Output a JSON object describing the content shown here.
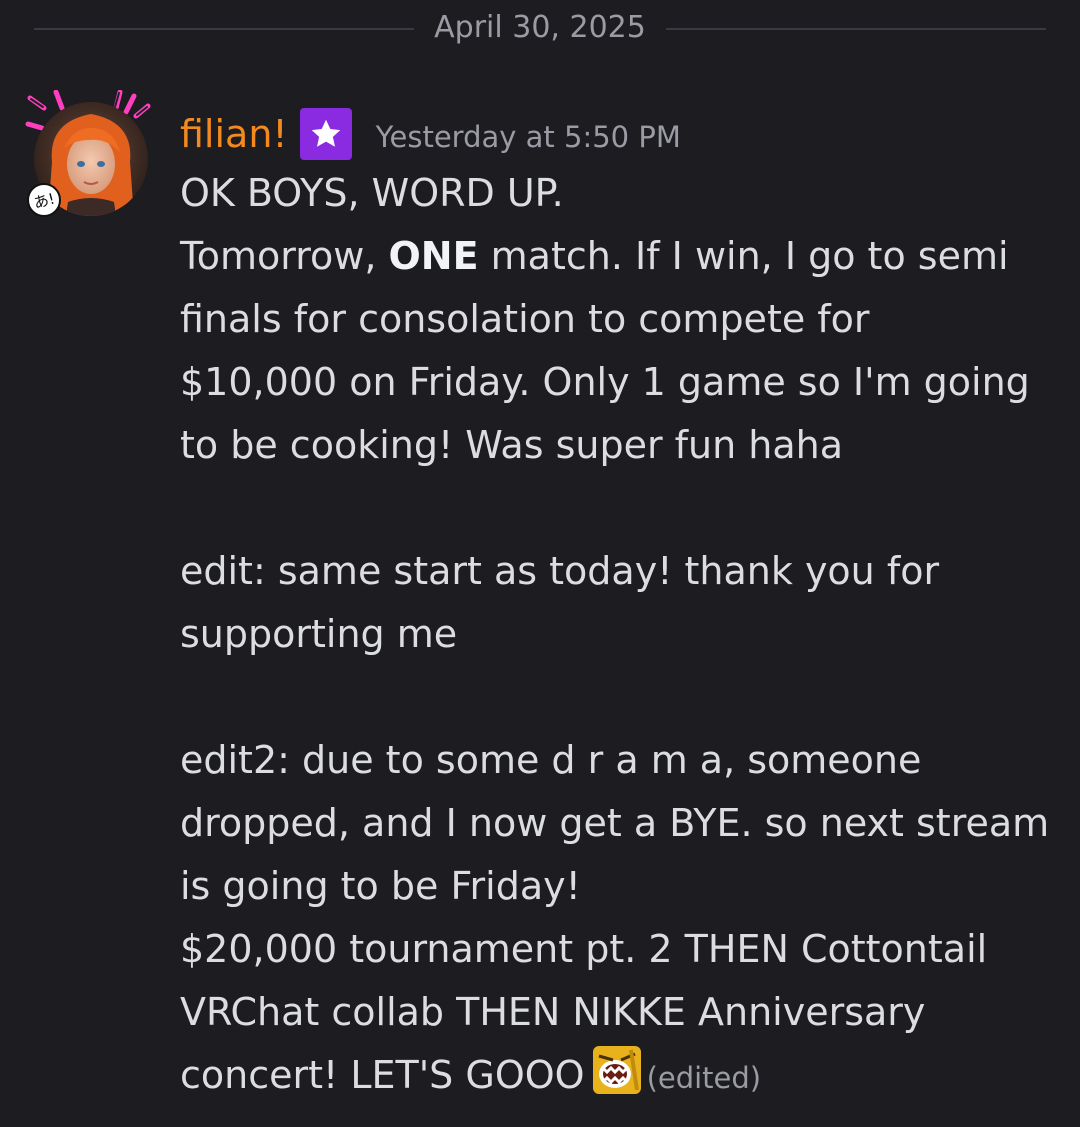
{
  "date_divider": "April 30, 2025",
  "author": {
    "name": "filian!",
    "role_badge_icon": "star-icon",
    "role_badge_color": "#8a2be2",
    "name_color": "#f28a1f",
    "avatar_badge_text": "あ!"
  },
  "timestamp": "Yesterday at 5:50 PM",
  "message": {
    "line1": "OK BOYS, WORD UP.",
    "line2_pre": "Tomorrow, ",
    "line2_bold": "ONE",
    "line2_post": " match. If I win, I go to semi",
    "line3": "finals for consolation to compete for",
    "line4": "$10,000 on Friday. Only 1 game so I'm going",
    "line5": "to be cooking! Was super fun haha",
    "line6": "edit: same start as today! thank you for",
    "line7": "supporting me",
    "line8": "edit2: due to some d r a m a, someone",
    "line9": "dropped, and I now get a BYE. so next stream",
    "line10": "is going to be Friday!",
    "line11": "$20,000 tournament pt. 2 THEN Cottontail",
    "line12": "VRChat collab THEN NIKKE Anniversary",
    "line13": "concert! LET'S GOOO",
    "emoji_name": "screaming-emoji-icon",
    "edited_label": "(edited)"
  }
}
